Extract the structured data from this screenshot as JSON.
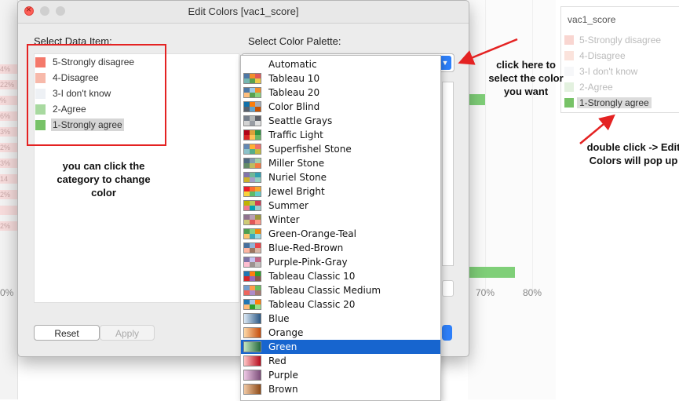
{
  "dialog": {
    "title": "Edit Colors [vac1_score]",
    "select_data_item_label": "Select Data Item:",
    "select_palette_label": "Select Color Palette:",
    "reset_label": "Reset",
    "apply_label": "Apply",
    "data_items": [
      {
        "label": "5-Strongly disagree",
        "color": "#f4796b"
      },
      {
        "label": "4-Disagree",
        "color": "#f7b9aa"
      },
      {
        "label": "3-I don't know",
        "color": "#eef1f5"
      },
      {
        "label": "2-Agree",
        "color": "#a8d9a0"
      },
      {
        "label": "1-Strongly agree",
        "color": "#77c267",
        "selected": true
      }
    ]
  },
  "palettes": [
    {
      "label": "Automatic",
      "icon": "none"
    },
    {
      "label": "Tableau 10",
      "icon": "tableau-10-swatch"
    },
    {
      "label": "Tableau 20",
      "icon": "tableau-20-swatch"
    },
    {
      "label": "Color Blind",
      "icon": "color-blind-swatch"
    },
    {
      "label": "Seattle Grays",
      "icon": "seattle-grays-swatch"
    },
    {
      "label": "Traffic Light",
      "icon": "traffic-light-swatch"
    },
    {
      "label": "Superfishel Stone",
      "icon": "superfishel-stone-swatch"
    },
    {
      "label": "Miller Stone",
      "icon": "miller-stone-swatch"
    },
    {
      "label": "Nuriel Stone",
      "icon": "nuriel-stone-swatch"
    },
    {
      "label": "Jewel Bright",
      "icon": "jewel-bright-swatch"
    },
    {
      "label": "Summer",
      "icon": "summer-swatch"
    },
    {
      "label": "Winter",
      "icon": "winter-swatch"
    },
    {
      "label": "Green-Orange-Teal",
      "icon": "green-orange-teal-swatch"
    },
    {
      "label": "Blue-Red-Brown",
      "icon": "blue-red-brown-swatch"
    },
    {
      "label": "Purple-Pink-Gray",
      "icon": "purple-pink-gray-swatch"
    },
    {
      "label": "Tableau Classic 10",
      "icon": "tableau-classic-10-swatch"
    },
    {
      "label": "Tableau Classic Medium",
      "icon": "tableau-classic-medium-swatch"
    },
    {
      "label": "Tableau Classic 20",
      "icon": "tableau-classic-20-swatch"
    },
    {
      "label": "Blue",
      "icon": "blue-gradient"
    },
    {
      "label": "Orange",
      "icon": "orange-gradient"
    },
    {
      "label": "Green",
      "icon": "green-gradient",
      "selected": true
    },
    {
      "label": "Red",
      "icon": "red-gradient"
    },
    {
      "label": "Purple",
      "icon": "purple-gradient"
    },
    {
      "label": "Brown",
      "icon": "brown-gradient"
    }
  ],
  "legend": {
    "title": "vac1_score",
    "items": [
      {
        "label": "5-Strongly disagree",
        "color": "#f9d6d1"
      },
      {
        "label": "4-Disagree",
        "color": "#fbe3dc"
      },
      {
        "label": "3-I don't know",
        "color": "#f6f7f9"
      },
      {
        "label": "2-Agree",
        "color": "#e3f1df"
      },
      {
        "label": "1-Strongly agree",
        "color": "#77c267",
        "selected": true
      }
    ]
  },
  "chart_background": {
    "axis_labels": [
      "0%",
      "70%",
      "80%"
    ],
    "left_bar_labels": [
      "4%",
      "22%",
      "%",
      "6%",
      "3%",
      "2%",
      "3%",
      "14",
      "2%",
      "",
      "2%"
    ]
  },
  "annotations": {
    "category_note": "you can click the category to change color",
    "palette_note": "click here to select the color you want",
    "legend_note": "double click -> Edit Colors will pop up"
  },
  "colors": {
    "accent": "#2d7ff9",
    "selection": "#1765cf",
    "annotation_red": "#e42222"
  }
}
